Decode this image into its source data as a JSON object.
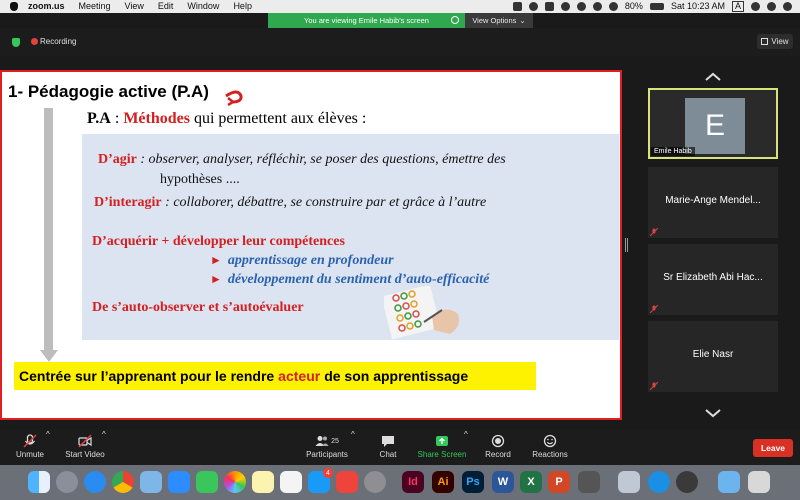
{
  "menubar": {
    "app_name": "zoom.us",
    "items": [
      "Meeting",
      "View",
      "Edit",
      "Window",
      "Help"
    ],
    "battery": "80%",
    "clock": "Sat 10:23 AM",
    "input_source": "A"
  },
  "banner": {
    "text": "You are viewing Emile Habib's screen",
    "view_options": "View Options"
  },
  "zoom_top": {
    "recording": "Recording",
    "view": "View"
  },
  "slide": {
    "title": "1- Pédagogie active (P.A)",
    "pa_prefix": "P.A",
    "pa_colon": " : ",
    "pa_highlight": "Méthodes",
    "pa_rest": " qui permettent aux élèves :",
    "agir_label": "D’agir",
    "agir_text": " : observer, analyser, réfléchir, se poser des questions, émettre des",
    "agir_text2": "hypothèses ....",
    "interagir_label": "D’interagir",
    "interagir_text": " : collaborer, débattre, se construire par et grâce à l’autre",
    "acquerir": "D’acquérir + développer leur compétences",
    "bullet1": "apprentissage en profondeur",
    "bullet2": "développement du sentiment d’auto-efficacité",
    "auto_observer": "De s’auto-observer et s’autoévaluer",
    "footer_start": "Centrée sur l’apprenant pour le rendre",
    "footer_highlight": "acteur",
    "footer_end": "de son apprentissage"
  },
  "participants": [
    {
      "initial": "E",
      "name": "Emile Habib",
      "active": true
    },
    {
      "name": "Marie-Ange Mendel...",
      "muted": true
    },
    {
      "name": "Sr Elizabeth Abi Hac...",
      "muted": true
    },
    {
      "name": "Elie Nasr",
      "muted": true
    }
  ],
  "toolbar": {
    "unmute": "Unmute",
    "start_video": "Start Video",
    "participants": "Participants",
    "participants_count": "25",
    "chat": "Chat",
    "share_screen": "Share Screen",
    "record": "Record",
    "reactions": "Reactions",
    "leave": "Leave"
  },
  "dock": {
    "icons": [
      "finder-icon",
      "launchpad-icon",
      "safari-icon",
      "chrome-icon",
      "preview-icon",
      "zoom-icon",
      "facetime-icon",
      "photos-icon",
      "notes-icon",
      "music-icon",
      "appstore-icon",
      "anydesk-icon",
      "system-preferences-icon",
      "indesign-icon",
      "illustrator-icon",
      "photoshop-icon",
      "word-icon",
      "excel-icon",
      "powerpoint-icon",
      "game-icon",
      "preview2-icon",
      "accessibility-icon",
      "capture-icon",
      "folder-icon",
      "trash-icon"
    ],
    "letters": {
      "indesign": "Id",
      "illustrator": "Ai",
      "photoshop": "Ps",
      "word": "W",
      "excel": "X",
      "powerpoint": "P"
    },
    "appstore_badge": "4"
  },
  "colors": {
    "slide_border": "#e02020",
    "accent_red": "#d42020",
    "accent_blue": "#2a62b0",
    "highlight_yellow": "#fff200",
    "banner_green": "#2fa84f",
    "active_tile_border": "#d8e37a",
    "leave_red": "#d93025"
  }
}
